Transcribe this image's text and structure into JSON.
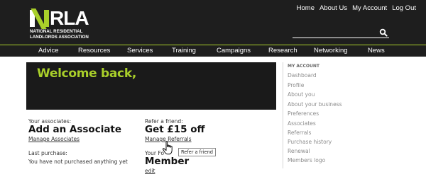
{
  "brand": {
    "logo_text": "NRLA",
    "logo_line1": "NATIONAL RESIDENTIAL",
    "logo_line2": "LANDLORDS ASSOCIATION",
    "accent_color": "#a9cf2a"
  },
  "top_links": [
    "Home",
    "About Us",
    "My Account",
    "Log Out"
  ],
  "search": {
    "placeholder": "",
    "icon": "search-icon"
  },
  "nav": [
    "Advice",
    "Resources",
    "Services",
    "Training",
    "Campaigns",
    "Research",
    "Networking",
    "News"
  ],
  "welcome": {
    "title": "Welcome back,"
  },
  "associates": {
    "label": "Your associates:",
    "heading": "Add an Associate",
    "link": "Manage Associates"
  },
  "referral": {
    "label": "Refer a friend:",
    "heading": "Get £15 off",
    "link": "Manage Referrals",
    "tooltip": "Refer a friend"
  },
  "purchase": {
    "label": "Last purchase:",
    "value": "You have not purchased anything yet"
  },
  "membership": {
    "label": "Your Fo",
    "heading": "Member",
    "link": "edit"
  },
  "sidebar": {
    "heading": "MY ACCOUNT",
    "items": [
      "Dashboard",
      "Profile",
      "About you",
      "About your business",
      "Preferences",
      "Associates",
      "Referrals",
      "Purchase history",
      "Renewal",
      "Members logo"
    ]
  }
}
